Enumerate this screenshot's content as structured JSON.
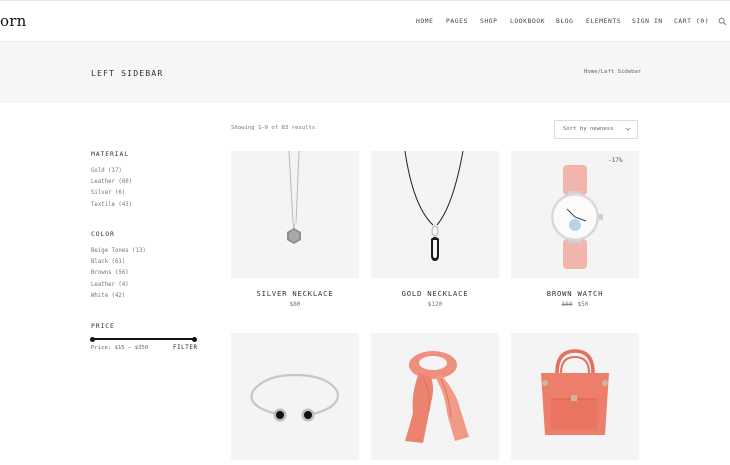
{
  "header": {
    "logo": "orn",
    "nav": [
      {
        "label": "HOME"
      },
      {
        "label": "PAGES"
      },
      {
        "label": "SHOP"
      },
      {
        "label": "LOOKBOOK"
      },
      {
        "label": "BLOG"
      },
      {
        "label": "ELEMENTS"
      },
      {
        "label": "SIGN IN"
      },
      {
        "label": "CART (0)"
      }
    ],
    "search_icon": "search-icon"
  },
  "title_band": {
    "title": "LEFT SIDEBAR",
    "breadcrumb_home": "Home",
    "breadcrumb_sep": "/",
    "breadcrumb_current": "Left Sidebar"
  },
  "sidebar": {
    "material": {
      "title": "MATERIAL",
      "items": [
        {
          "label": "Gold (17)"
        },
        {
          "label": "Leather (60)"
        },
        {
          "label": "Silver (6)"
        },
        {
          "label": "Textile (43)"
        }
      ]
    },
    "color": {
      "title": "COLOR",
      "items": [
        {
          "label": "Beige Tones (13)"
        },
        {
          "label": "Black (61)"
        },
        {
          "label": "Browns (56)"
        },
        {
          "label": "Leather (4)"
        },
        {
          "label": "White (42)"
        }
      ]
    },
    "price": {
      "title": "PRICE",
      "range_text": "Price: $15 — $350",
      "filter_label": "FILTER"
    }
  },
  "toolbar": {
    "result_count": "Showing 1–9 of 83 results",
    "sort_value": "Sort by newness",
    "sort_icon": "chevron-down-icon"
  },
  "products": [
    {
      "name": "SILVER NECKLACE",
      "price": "$80",
      "old_price": "",
      "badge": ""
    },
    {
      "name": "GOLD NECKLACE",
      "price": "$120",
      "old_price": "",
      "badge": ""
    },
    {
      "name": "BROWN WATCH",
      "price": "$50",
      "old_price": "$60",
      "badge": "-17%"
    },
    {
      "name": "",
      "price": "",
      "old_price": "",
      "badge": ""
    },
    {
      "name": "",
      "price": "",
      "old_price": "",
      "badge": ""
    },
    {
      "name": "",
      "price": "",
      "old_price": "",
      "badge": ""
    }
  ],
  "colors": {
    "title_band_bg": "#f6f6f6",
    "product_bg": "#f4f4f4",
    "watch_strap": "#f2b5ac",
    "scarf": "#f08a78",
    "bag": "#ee7e6c"
  }
}
